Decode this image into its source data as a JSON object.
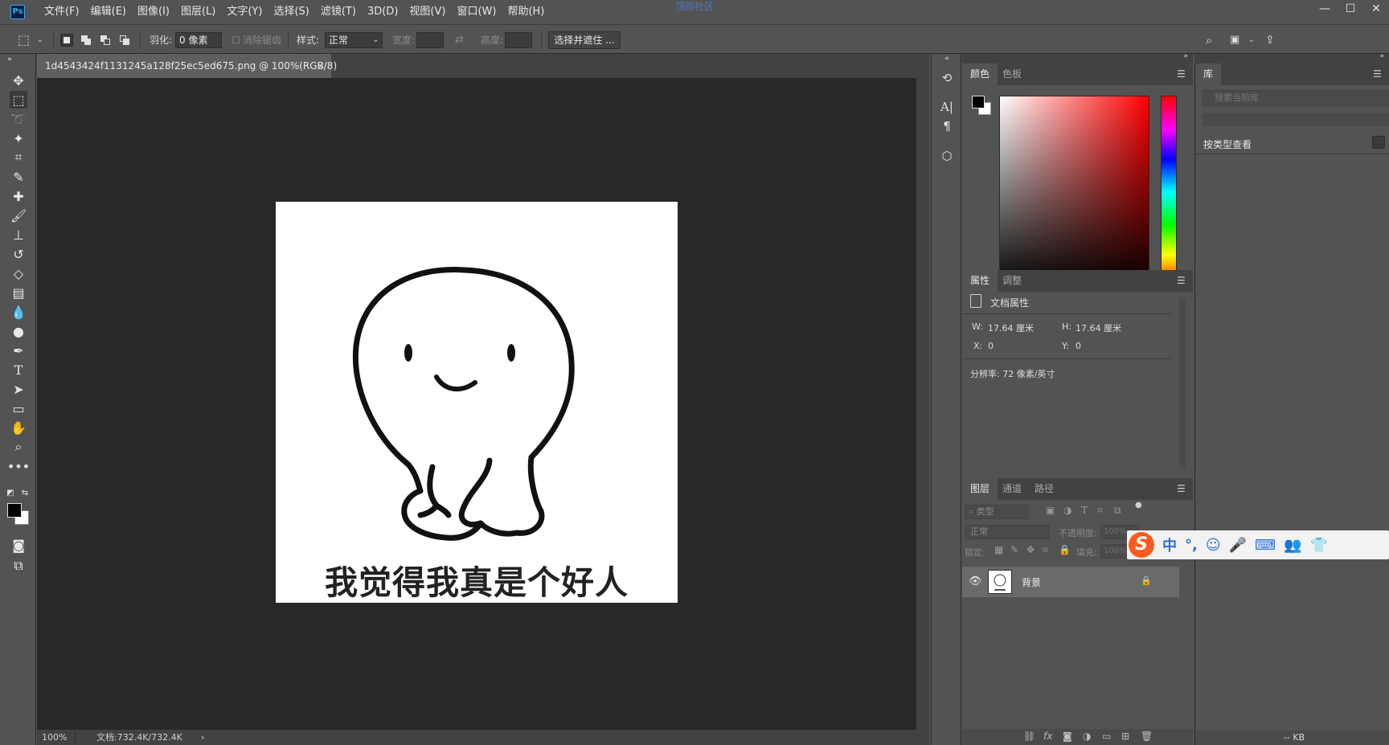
{
  "app": {
    "logo": "Ps",
    "menu": [
      "文件(F)",
      "编辑(E)",
      "图像(I)",
      "图层(L)",
      "文字(Y)",
      "选择(S)",
      "滤镜(T)",
      "3D(D)",
      "视图(V)",
      "窗口(W)",
      "帮助(H)"
    ],
    "watermark": "顶部社区",
    "window_controls": [
      "—",
      "☐",
      "✕"
    ]
  },
  "options": {
    "feather_label": "羽化:",
    "feather_value": "0 像素",
    "antialias_label": "消除锯齿",
    "style_label": "样式:",
    "style_value": "正常",
    "width_label": "宽度:",
    "height_label": "高度:",
    "select_mask_button": "选择并遮住 ..."
  },
  "document": {
    "tab_title": "1d4543424f1131245a128f25ec5ed675.png @ 100%(RGB/8)",
    "tab_close": "×",
    "image_caption": "我觉得我真是个好人",
    "zoom": "100%",
    "doc_size": "文档:732.4K/732.4K",
    "status_arrow": "›"
  },
  "color_panel": {
    "tabs": [
      "颜色",
      "色板"
    ],
    "foreground": "#000000",
    "background": "#ffffff"
  },
  "properties_panel": {
    "tabs": [
      "属性",
      "调整"
    ],
    "section_title": "文档属性",
    "w_label": "W:",
    "w_value": "17.64 厘米",
    "h_label": "H:",
    "h_value": "17.64 厘米",
    "x_label": "X:",
    "x_value": "0",
    "y_label": "Y:",
    "y_value": "0",
    "resolution": "分辨率: 72 像素/英寸"
  },
  "layers_panel": {
    "tabs": [
      "图层",
      "通道",
      "路径"
    ],
    "filter_placeholder": "类型",
    "blend_mode": "正常",
    "opacity_label": "不透明度:",
    "opacity_value": "100%",
    "lock_label": "锁定:",
    "fill_label": "填充:",
    "fill_value": "100%",
    "layers": [
      {
        "name": "背景",
        "visible": true,
        "locked": true
      }
    ]
  },
  "library_panel": {
    "tab": "库",
    "search_placeholder": "搜索当前库",
    "view_by_type": "按类型查看",
    "size": "-- KB"
  },
  "ime": {
    "logo": "S",
    "items": [
      "中",
      "°,",
      "☺",
      "🎤",
      "⌨",
      "👥",
      "👕"
    ]
  }
}
